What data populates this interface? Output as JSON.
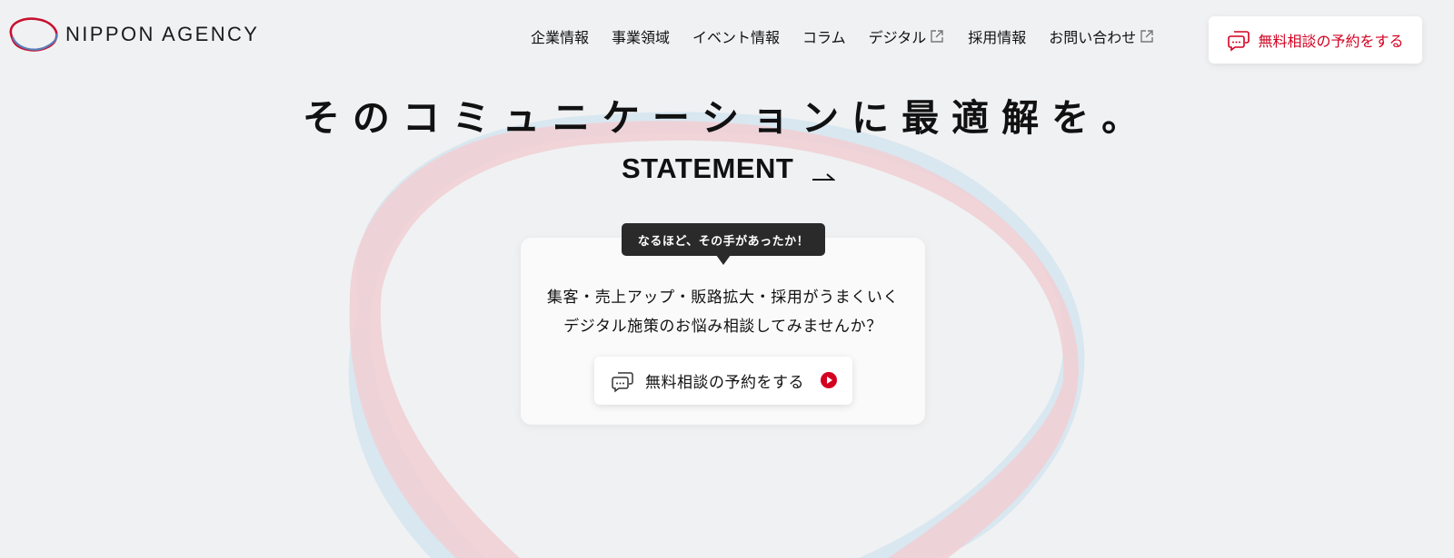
{
  "header": {
    "logo_text": "NIPPON AGENCY",
    "nav": [
      {
        "label": "企業情報",
        "external": false
      },
      {
        "label": "事業領域",
        "external": false
      },
      {
        "label": "イベント情報",
        "external": false
      },
      {
        "label": "コラム",
        "external": false
      },
      {
        "label": "デジタル",
        "external": true
      },
      {
        "label": "採用情報",
        "external": false
      },
      {
        "label": "お問い合わせ",
        "external": true
      }
    ],
    "cta_label": "無料相談の予約をする"
  },
  "hero": {
    "headline": "そのコミュニケーションに最適解を。",
    "statement_label": "STATEMENT"
  },
  "card": {
    "bubble": "なるほど、その手があったか！",
    "line1": "集客・売上アップ・販路拡大・採用がうまくいく",
    "line2": "デジタル施策のお悩み相談してみませんか？",
    "button_label": "無料相談の予約をする"
  },
  "colors": {
    "accent": "#d40020",
    "background": "#f0f1f3",
    "ribbon_red": "#f1cfd4",
    "ribbon_blue": "#cfe5ef",
    "bubble": "#2a2a2a"
  },
  "icons": {
    "external": "external-link-icon",
    "chat": "chat-bubbles-icon",
    "arrow": "arrow-right-icon",
    "play": "play-circle-icon"
  }
}
